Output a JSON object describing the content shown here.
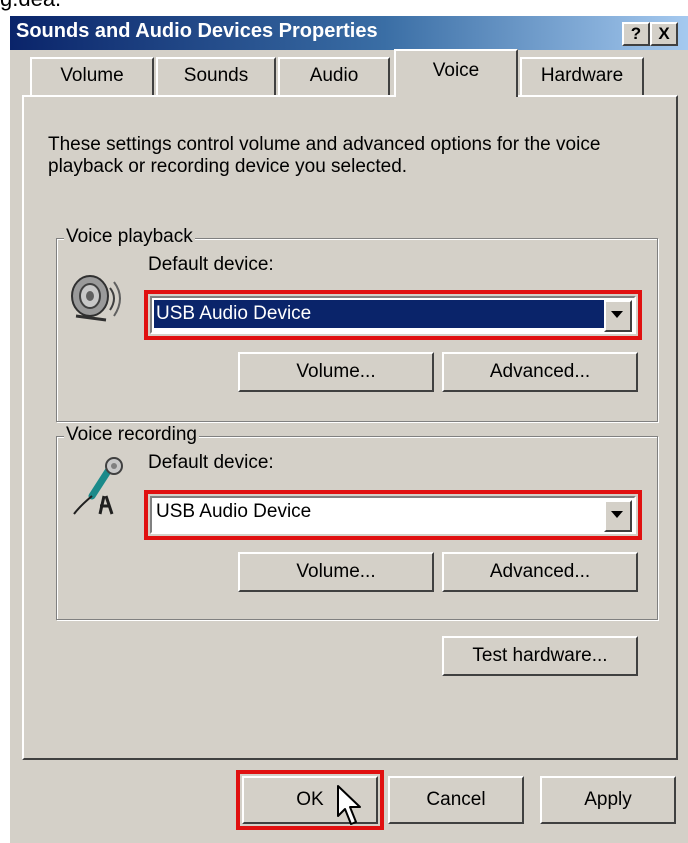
{
  "fragment_text": "g.dea.",
  "window": {
    "title": "Sounds and Audio Devices Properties",
    "help_btn": "?",
    "close_btn": "X"
  },
  "tabs": [
    {
      "label": "Volume",
      "active": false
    },
    {
      "label": "Sounds",
      "active": false
    },
    {
      "label": "Audio",
      "active": false
    },
    {
      "label": "Voice",
      "active": true
    },
    {
      "label": "Hardware",
      "active": false
    }
  ],
  "description": "These settings control volume and advanced options for the voice playback or recording device you selected.",
  "playback": {
    "group_label": "Voice playback",
    "device_label": "Default device:",
    "device_value": "USB Audio Device",
    "volume_btn": "Volume...",
    "advanced_btn": "Advanced..."
  },
  "recording": {
    "group_label": "Voice recording",
    "device_label": "Default device:",
    "device_value": "USB Audio Device",
    "volume_btn": "Volume...",
    "advanced_btn": "Advanced..."
  },
  "test_btn": "Test hardware...",
  "footer": {
    "ok": "OK",
    "cancel": "Cancel",
    "apply": "Apply"
  },
  "colors": {
    "highlight_outline": "#e01010",
    "selection": "#0a246a",
    "face": "#d4d0c8"
  }
}
